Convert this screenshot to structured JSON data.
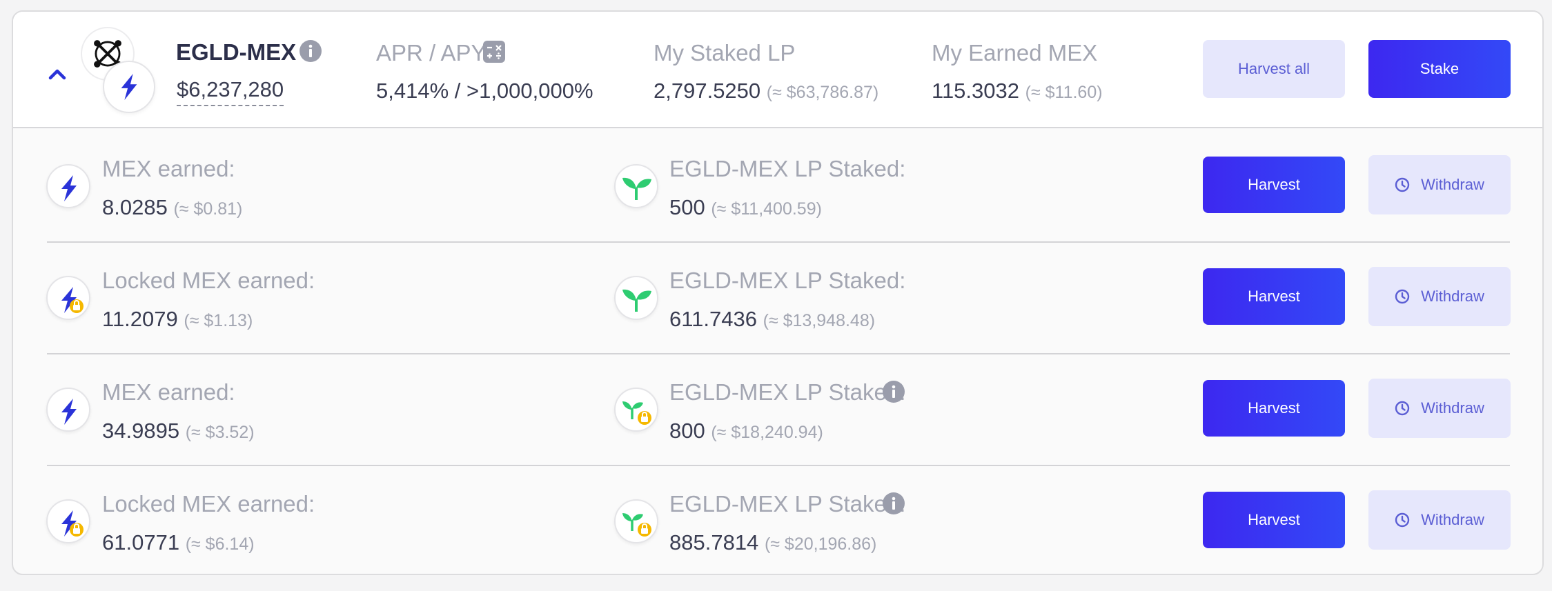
{
  "farm": {
    "pair_name": "EGLD-MEX",
    "tvl": "$6,237,280",
    "apr_label": "APR / APY",
    "apr_value": "5,414% / >1,000,000%",
    "staked_label": "My Staked LP",
    "staked_value": "2,797.5250",
    "staked_usd": "(≈ $63,786.87)",
    "earned_label": "My Earned MEX",
    "earned_value": "115.3032",
    "earned_usd": "(≈ $11.60)",
    "harvest_all_label": "Harvest all",
    "stake_label": "Stake"
  },
  "positions": [
    {
      "reward_label": "MEX earned:",
      "reward_value": "8.0285",
      "reward_usd": "(≈ $0.81)",
      "reward_locked": false,
      "lp_label": "EGLD-MEX LP Staked:",
      "lp_value": "500",
      "lp_usd": "(≈ $11,400.59)",
      "lp_locked": false,
      "harvest_label": "Harvest",
      "withdraw_label": "Withdraw"
    },
    {
      "reward_label": "Locked MEX earned:",
      "reward_value": "11.2079",
      "reward_usd": "(≈ $1.13)",
      "reward_locked": true,
      "lp_label": "EGLD-MEX LP Staked:",
      "lp_value": "611.7436",
      "lp_usd": "(≈ $13,948.48)",
      "lp_locked": false,
      "harvest_label": "Harvest",
      "withdraw_label": "Withdraw"
    },
    {
      "reward_label": "MEX earned:",
      "reward_value": "34.9895",
      "reward_usd": "(≈ $3.52)",
      "reward_locked": false,
      "lp_label": "EGLD-MEX LP Staked:",
      "lp_value": "800",
      "lp_usd": "(≈ $18,240.94)",
      "lp_locked": true,
      "harvest_label": "Harvest",
      "withdraw_label": "Withdraw"
    },
    {
      "reward_label": "Locked MEX earned:",
      "reward_value": "61.0771",
      "reward_usd": "(≈ $6.14)",
      "reward_locked": true,
      "lp_label": "EGLD-MEX LP Staked:",
      "lp_value": "885.7814",
      "lp_usd": "(≈ $20,196.86)",
      "lp_locked": true,
      "harvest_label": "Harvest",
      "withdraw_label": "Withdraw"
    }
  ],
  "colors": {
    "primary": "#3d28f0",
    "light_button": "#e6e7fc",
    "sprout_green": "#2ecc71",
    "lock_yellow": "#f5b800",
    "bolt_blue": "#2a33d8"
  }
}
